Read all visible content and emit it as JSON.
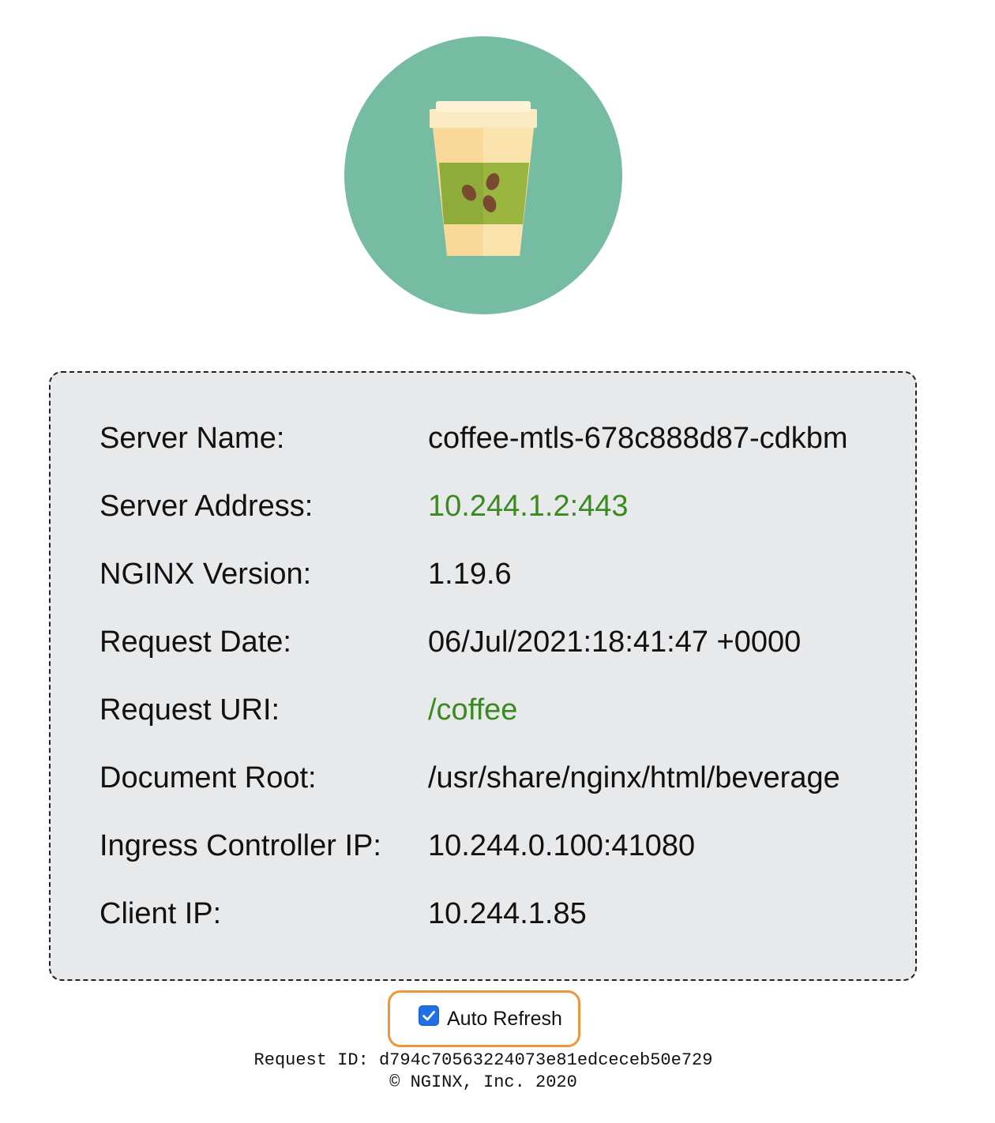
{
  "logo": {
    "icon": "coffee-cup-icon",
    "background_color": "#76bca2"
  },
  "info": {
    "rows": [
      {
        "label": "Server Name:",
        "value": "coffee-mtls-678c888d87-cdkbm"
      },
      {
        "label": "Server Address:",
        "value": "10.244.1.2:443"
      },
      {
        "label": "NGINX Version:",
        "value": "1.19.6"
      },
      {
        "label": "Request Date:",
        "value": "06/Jul/2021:18:41:47 +0000"
      },
      {
        "label": "Request URI:",
        "value": "/coffee"
      },
      {
        "label": "Document Root:",
        "value": "/usr/share/nginx/html/beverage"
      },
      {
        "label": "Ingress Controller IP:",
        "value": "10.244.0.100:41080"
      },
      {
        "label": "Client IP:",
        "value": "10.244.1.85"
      }
    ]
  },
  "auto_refresh": {
    "label": "Auto Refresh",
    "checked": true
  },
  "footer": {
    "request_id": "Request ID: d794c70563224073e81edceceb50e729",
    "copyright": "© NGINX, Inc. 2020"
  },
  "colors": {
    "highlight_value": "#3a8a20",
    "refresh_outline": "#f0953a",
    "checkbox": "#1f6fe6"
  }
}
